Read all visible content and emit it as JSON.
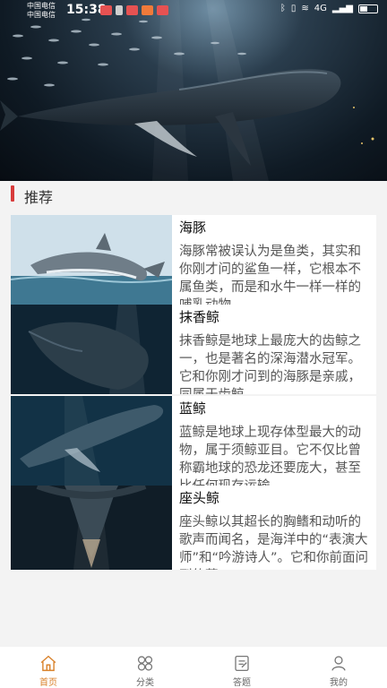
{
  "status_bar": {
    "carrier_1": "中国电信",
    "carrier_2": "中国电信",
    "time": "15:38",
    "signal_label": "4G"
  },
  "hero": {
    "icon": "humpback-whale-photo"
  },
  "section": {
    "title": "推荐"
  },
  "list": [
    {
      "name": "海豚",
      "description": "海豚常被误认为是鱼类，其实和你刚才问的鲨鱼一样，它根本不属鱼类，而是和水牛一样一样的哺乳动物",
      "icon": "dolphin-photo"
    },
    {
      "name": "抹香鲸",
      "description": "抹香鲸是地球上最庞大的齿鲸之一，也是著名的深海潜水冠军。它和你刚才问到的海豚是亲戚，同属于齿鲸",
      "icon": "sperm-whale-photo"
    },
    {
      "name": "蓝鲸",
      "description": "蓝鲸是地球上现存体型最大的动物，属于须鲸亚目。它不仅比曾称霸地球的恐龙还要庞大，甚至比任何现存运输",
      "icon": "blue-whale-photo"
    },
    {
      "name": "座头鲸",
      "description": "座头鲸以其超长的胸鳍和动听的歌声而闻名，是海洋中的“表演大师”和“吟游诗人”。它和你前面问到的蓝",
      "icon": "humpback-whale-photo"
    }
  ],
  "nav": [
    {
      "label": "首页",
      "icon": "home-icon",
      "active": true
    },
    {
      "label": "分类",
      "icon": "category-icon",
      "active": false
    },
    {
      "label": "答题",
      "icon": "quiz-icon",
      "active": false
    },
    {
      "label": "我的",
      "icon": "profile-icon",
      "active": false
    }
  ],
  "colors": {
    "accent": "#d9822b",
    "section_bar": "#d83b3b"
  }
}
